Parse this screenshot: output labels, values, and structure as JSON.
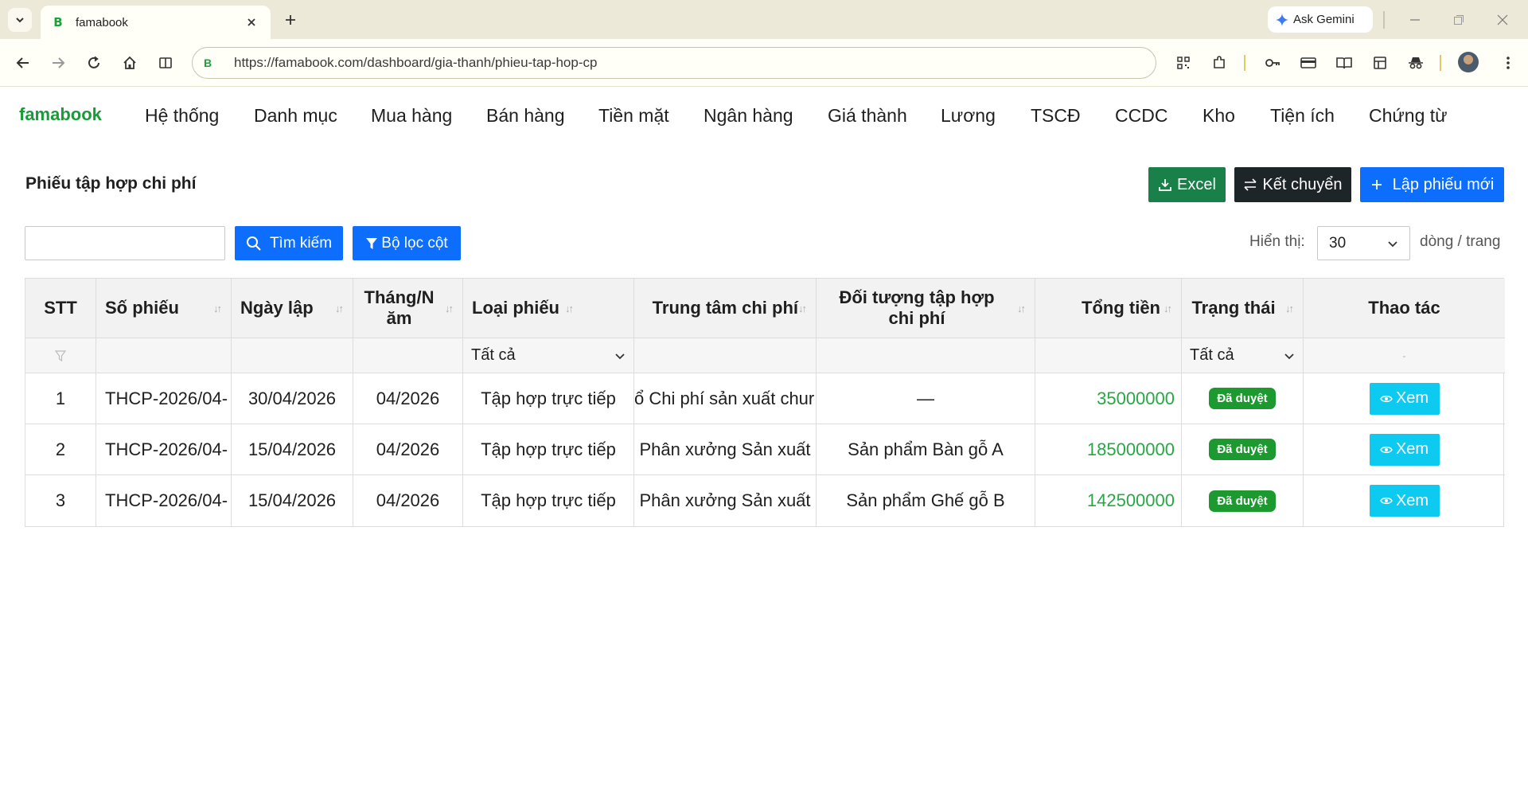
{
  "browser": {
    "tab_title": "famabook",
    "favicon_letter": "B",
    "ask_gemini": "Ask Gemini",
    "url": "https://famabook.com/dashboard/gia-thanh/phieu-tap-hop-cp"
  },
  "app": {
    "brand": "famabook",
    "menu": [
      "Hệ thống",
      "Danh mục",
      "Mua hàng",
      "Bán hàng",
      "Tiền mặt",
      "Ngân hàng",
      "Giá thành",
      "Lương",
      "TSCĐ",
      "CCDC",
      "Kho",
      "Tiện ích",
      "Chứng từ"
    ]
  },
  "page": {
    "title": "Phiếu tập hợp chi phí",
    "excel_label": "Excel",
    "ket_chuyen_label": "Kết chuyển",
    "new_label": "Lập phiếu mới",
    "search_placeholder": "",
    "search_label": "Tìm kiếm",
    "filter_label": "Bộ lọc cột",
    "show_label": "Hiển thị:",
    "page_size": "30",
    "rows_label": "dòng / trang"
  },
  "table": {
    "columns": [
      "STT",
      "Số phiếu",
      "Ngày lập",
      "Tháng/Năm",
      "Loại phiếu",
      "Trung tâm chi phí",
      "Đối tượng tập hợp chi phí",
      "Tổng tiền",
      "Trạng thái",
      "Thao tác"
    ],
    "filters": {
      "loai_phieu": "Tất cả",
      "trang_thai": "Tất cả",
      "thao_tac": "-"
    },
    "rows": [
      {
        "stt": "1",
        "so_phieu": "THCP-2026/04-",
        "ngay_lap": "30/04/2026",
        "thang_nam": "04/2026",
        "loai_phieu": "Tập hợp trực tiếp",
        "trung_tam": "ổ Chi phí sản xuất chur",
        "doi_tuong": "—",
        "tong_tien": "35000000",
        "trang_thai": "Đã duyệt",
        "action": "Xem"
      },
      {
        "stt": "2",
        "so_phieu": "THCP-2026/04-",
        "ngay_lap": "15/04/2026",
        "thang_nam": "04/2026",
        "loai_phieu": "Tập hợp trực tiếp",
        "trung_tam": "Phân xưởng Sản xuất",
        "doi_tuong": "Sản phẩm Bàn gỗ A",
        "tong_tien": "185000000",
        "trang_thai": "Đã duyệt",
        "action": "Xem"
      },
      {
        "stt": "3",
        "so_phieu": "THCP-2026/04-",
        "ngay_lap": "15/04/2026",
        "thang_nam": "04/2026",
        "loai_phieu": "Tập hợp trực tiếp",
        "trung_tam": "Phân xưởng Sản xuất",
        "doi_tuong": "Sản phẩm Ghế gỗ B",
        "tong_tien": "142500000",
        "trang_thai": "Đã duyệt",
        "action": "Xem"
      }
    ]
  },
  "colors": {
    "brand": "#1b9a3a",
    "primary": "#0d6efd",
    "excel": "#188048",
    "dark": "#1e2528",
    "info": "#0dcaf0",
    "success": "#1c9a2f"
  }
}
